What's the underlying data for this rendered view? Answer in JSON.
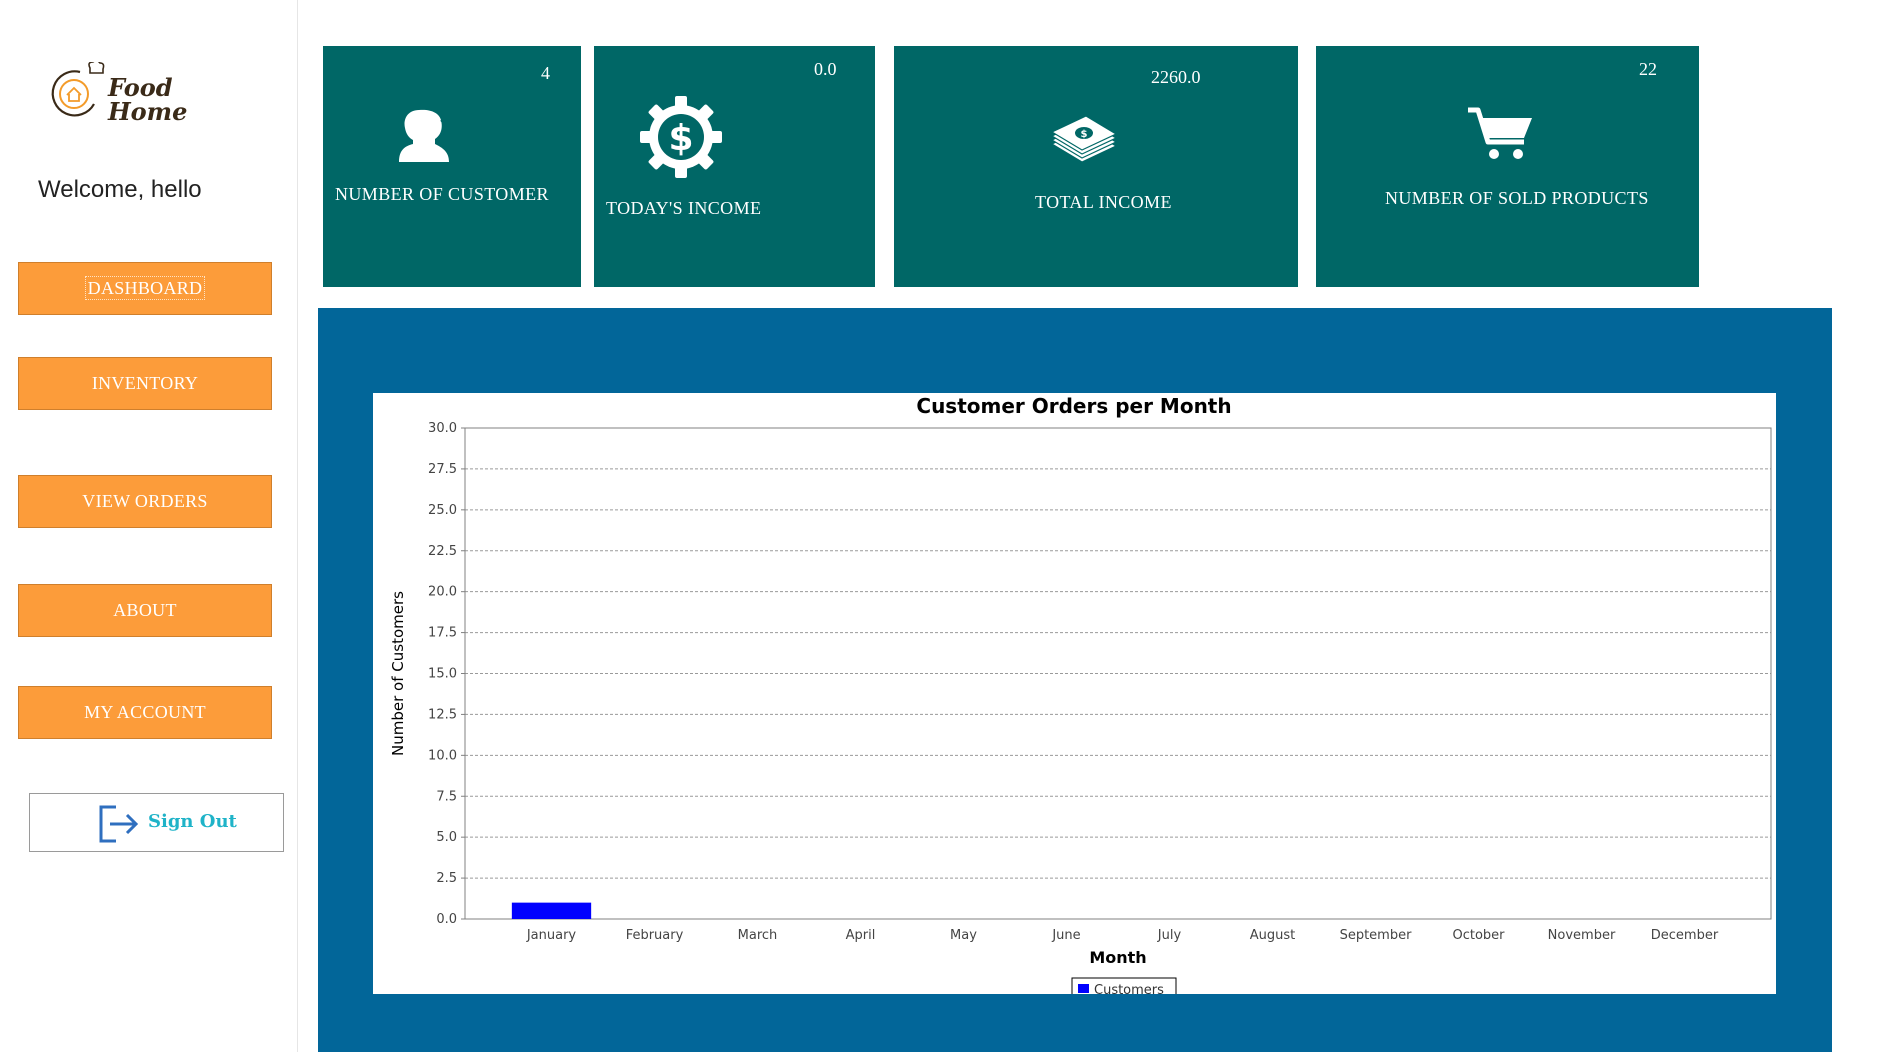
{
  "app": {
    "logo_line1": "Food",
    "logo_line2": "Home",
    "welcome": "Welcome, hello"
  },
  "sidebar": {
    "items": [
      {
        "label": "DASHBOARD",
        "active": true
      },
      {
        "label": "INVENTORY",
        "active": false
      },
      {
        "label": "VIEW ORDERS",
        "active": false
      },
      {
        "label": "ABOUT",
        "active": false
      },
      {
        "label": "MY ACCOUNT",
        "active": false
      }
    ],
    "signout_label": "Sign Out",
    "button_color": "#fc9c3a"
  },
  "cards": [
    {
      "label": "NUMBER OF CUSTOMER",
      "value": "4",
      "icon": "customer-icon"
    },
    {
      "label": "TODAY'S  INCOME",
      "value": "0.0",
      "icon": "dollar-gear-icon"
    },
    {
      "label": "TOTAL  INCOME",
      "value": "2260.0",
      "icon": "money-stack-icon"
    },
    {
      "label": "NUMBER OF SOLD PRODUCTS",
      "value": "22",
      "icon": "cart-icon"
    }
  ],
  "colors": {
    "card_bg": "#006766",
    "panel_bg": "#026699",
    "bar": "#0000ff",
    "signout_text": "#1fb3c8"
  },
  "chart_data": {
    "type": "bar",
    "title": "Customer Orders per Month",
    "xlabel": "Month",
    "ylabel": "Number of Customers",
    "categories": [
      "January",
      "February",
      "March",
      "April",
      "May",
      "June",
      "July",
      "August",
      "September",
      "October",
      "November",
      "December"
    ],
    "series": [
      {
        "name": "Customers",
        "values": [
          1,
          0,
          0,
          0,
          0,
          0,
          0,
          0,
          0,
          0,
          0,
          0
        ],
        "color": "#0000ff"
      }
    ],
    "ylim": [
      0,
      30
    ],
    "yticks": [
      "0.0",
      "2.5",
      "5.0",
      "7.5",
      "10.0",
      "12.5",
      "15.0",
      "17.5",
      "20.0",
      "22.5",
      "25.0",
      "27.5",
      "30.0"
    ],
    "grid": true,
    "legend_position": "bottom-center"
  }
}
